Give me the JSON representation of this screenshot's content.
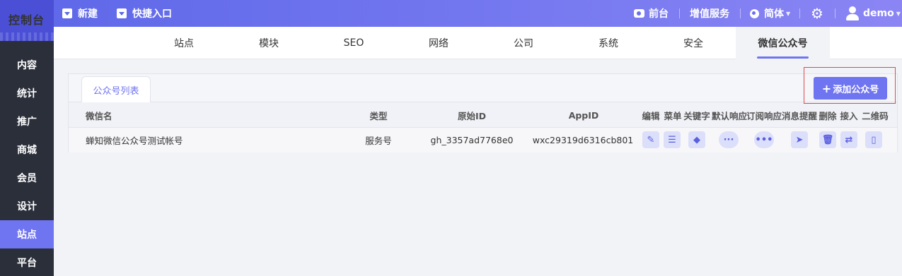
{
  "topbar": {
    "logo_text": "控制台",
    "new_label": "新建",
    "quick_label": "快捷入口",
    "front_label": "前台",
    "vas_label": "增值服务",
    "lang_label": "简体",
    "user_label": "demo"
  },
  "sidebar": {
    "items": [
      {
        "label": "内容"
      },
      {
        "label": "统计"
      },
      {
        "label": "推广"
      },
      {
        "label": "商城"
      },
      {
        "label": "会员"
      },
      {
        "label": "设计"
      },
      {
        "label": "站点",
        "active": true
      },
      {
        "label": "平台"
      }
    ]
  },
  "tabs": [
    {
      "label": "站点"
    },
    {
      "label": "模块"
    },
    {
      "label": "SEO"
    },
    {
      "label": "网络"
    },
    {
      "label": "公司"
    },
    {
      "label": "系统"
    },
    {
      "label": "安全"
    },
    {
      "label": "微信公众号",
      "active": true
    }
  ],
  "panel": {
    "tab_label": "公众号列表",
    "add_button": "添加公众号",
    "columns": {
      "name": "微信名",
      "type": "类型",
      "original_id": "原始ID",
      "appid": "AppID",
      "edit": "编辑",
      "menu": "菜单",
      "keywords": "关键字",
      "default_reply": "默认响应",
      "subscribe_reply": "订阅响应",
      "message_alert": "消息提醒",
      "delete": "删除",
      "connect": "接入",
      "qrcode": "二维码"
    },
    "rows": [
      {
        "name": "蝉知微信公众号测试帐号",
        "type": "服务号",
        "original_id": "gh_3357ad7768e0",
        "appid": "wxc29319d6316cb801"
      }
    ]
  },
  "colors": {
    "accent": "#6f74f0",
    "topbar": "#6a6ff0",
    "sidebar": "#2b2f3a",
    "highlight_border": "#e04a4a"
  }
}
